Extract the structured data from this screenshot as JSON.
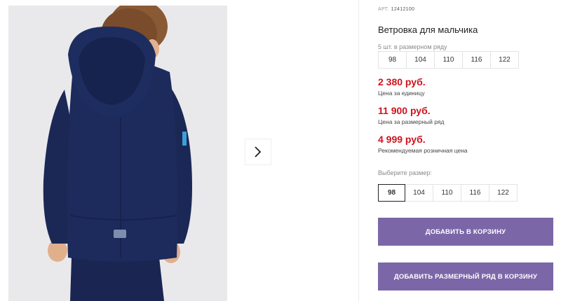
{
  "product": {
    "article_label": "АРТ.",
    "article_number": "12412100",
    "title": "Ветровка для мальчика",
    "pack_note": "5 шт. в размерном ряду",
    "pack_sizes": [
      "98",
      "104",
      "110",
      "116",
      "122"
    ],
    "prices": [
      {
        "value": "2 380 руб.",
        "label": "Цена за единицу"
      },
      {
        "value": "11 900 руб.",
        "label": "Цена за размерный ряд"
      },
      {
        "value": "4 999 руб.",
        "label": "Рекомендуемая розничная цена"
      }
    ],
    "choose_label": "Выберите размер:",
    "select_sizes": [
      "98",
      "104",
      "110",
      "116",
      "122"
    ],
    "selected_size": "98",
    "add_to_cart": "ДОБАВИТЬ В КОРЗИНУ",
    "add_set_to_cart": "ДОБАВИТЬ РАЗМЕРНЫЙ РЯД В КОРЗИНУ"
  },
  "gallery": {
    "next_icon": "chevron-right-icon",
    "photo": "boy-in-navy-jacket-back-view"
  },
  "colors": {
    "price": "#d0121c",
    "button": "#7b67a8",
    "jacket": "#1c2a5c"
  }
}
